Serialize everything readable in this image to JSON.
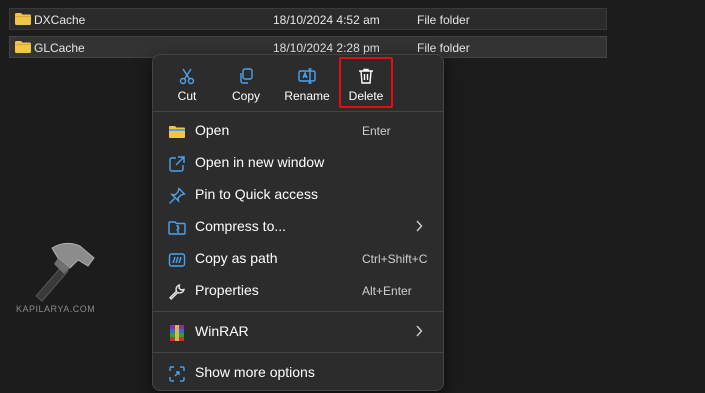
{
  "files": [
    {
      "name": "DXCache",
      "date": "18/10/2024 4:52 am",
      "type": "File folder"
    },
    {
      "name": "GLCache",
      "date": "18/10/2024 2:28 pm",
      "type": "File folder"
    }
  ],
  "context_menu": {
    "actions": [
      {
        "label": "Cut",
        "icon": "scissors-icon"
      },
      {
        "label": "Copy",
        "icon": "copy-icon"
      },
      {
        "label": "Rename",
        "icon": "rename-icon"
      },
      {
        "label": "Delete",
        "icon": "trash-icon",
        "highlighted": true
      }
    ],
    "items": [
      {
        "label": "Open",
        "shortcut": "Enter",
        "icon": "folder-open-icon"
      },
      {
        "label": "Open in new window",
        "shortcut": "",
        "icon": "open-external-icon"
      },
      {
        "label": "Pin to Quick access",
        "shortcut": "",
        "icon": "pin-icon"
      },
      {
        "label": "Compress to...",
        "shortcut": "",
        "icon": "compress-icon",
        "submenu": true
      },
      {
        "label": "Copy as path",
        "shortcut": "Ctrl+Shift+C",
        "icon": "copy-path-icon"
      },
      {
        "label": "Properties",
        "shortcut": "Alt+Enter",
        "icon": "wrench-icon"
      },
      {
        "label": "WinRAR",
        "shortcut": "",
        "icon": "winrar-icon",
        "submenu": true
      },
      {
        "label": "Show more options",
        "shortcut": "",
        "icon": "more-options-icon"
      }
    ]
  },
  "watermark": {
    "text": "KAPILARYA.COM"
  },
  "colors": {
    "highlight": "#e01010",
    "menu_bg": "#2c2c2c",
    "folder": "#f0c54c",
    "accent_blue": "#4aa3f0"
  }
}
